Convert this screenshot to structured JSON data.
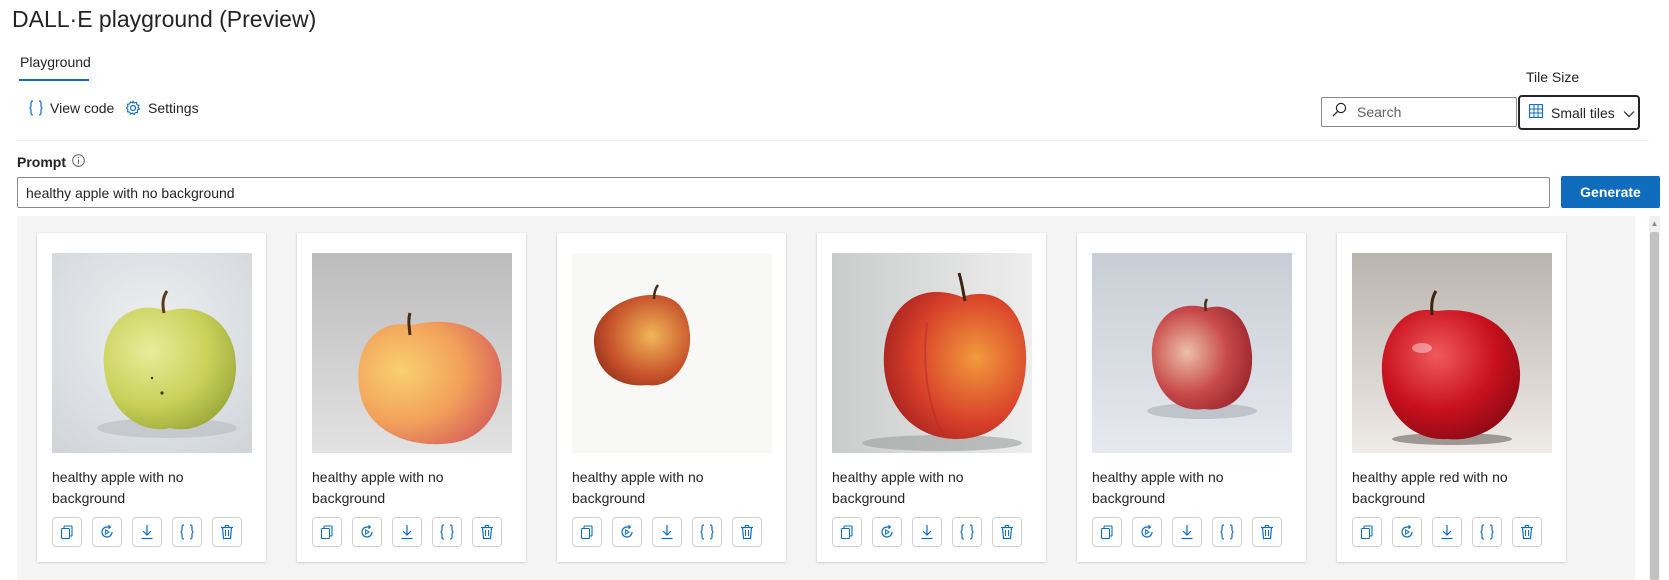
{
  "page": {
    "title": "DALL·E playground (Preview)"
  },
  "tabs": [
    {
      "label": "Playground"
    }
  ],
  "toolbar": {
    "view_code_label": "View code",
    "settings_label": "Settings"
  },
  "tile_size": {
    "label": "Tile Size",
    "selected": "Small tiles"
  },
  "search": {
    "placeholder": "Search"
  },
  "prompt": {
    "label": "Prompt",
    "value": "healthy apple with no background"
  },
  "generate_label": "Generate",
  "colors": {
    "accent": "#0f6cbd",
    "text": "#242424",
    "gallery_bg": "#f5f5f5"
  },
  "icons": {
    "view_code": "curly-braces-icon",
    "settings": "gear-icon",
    "search": "magnifier-icon",
    "tile_size": "grid-icon",
    "dropdown": "chevron-down-icon",
    "info": "info-icon",
    "card_actions": [
      "copy-icon",
      "regenerate-icon",
      "download-icon",
      "curly-braces-icon",
      "trash-icon"
    ]
  },
  "images": [
    {
      "caption": "healthy apple with no background",
      "apple": "yellow-green"
    },
    {
      "caption": "healthy apple with no background",
      "apple": "yellow-red"
    },
    {
      "caption": "healthy apple with no background",
      "apple": "small-red"
    },
    {
      "caption": "healthy apple with no background",
      "apple": "striped-red"
    },
    {
      "caption": "healthy apple with no background",
      "apple": "red-gala"
    },
    {
      "caption": "healthy apple red with no background",
      "apple": "deep-red"
    }
  ]
}
